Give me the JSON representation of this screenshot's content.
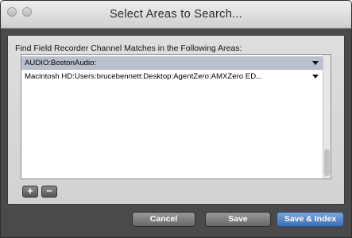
{
  "window": {
    "title": "Select Areas to Search..."
  },
  "prompt": "Find Field Recorder Channel Matches in the Following Areas:",
  "areas": [
    {
      "label": "AUDIO:BostonAudio:",
      "selected": true
    },
    {
      "label": "Macintosh HD:Users:brucebennett:Desktop:AgentZero:AMXZero ED...",
      "selected": false
    }
  ],
  "controls": {
    "add_label": "+",
    "remove_label": "−"
  },
  "buttons": {
    "cancel": "Cancel",
    "save": "Save",
    "save_index": "Save & Index"
  }
}
